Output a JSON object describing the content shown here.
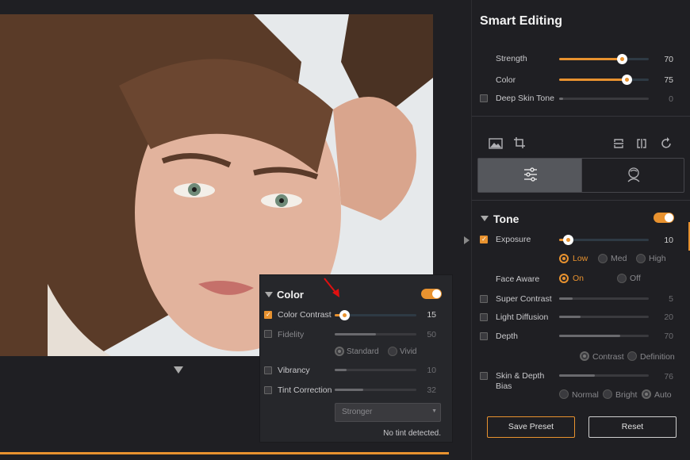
{
  "smart_editing": {
    "title": "Smart Editing",
    "strength": {
      "label": "Strength",
      "value": "70",
      "level": 0.7
    },
    "color": {
      "label": "Color",
      "value": "75",
      "level": 0.75
    },
    "deep_skin_tone": {
      "label": "Deep Skin Tone",
      "value": "0",
      "level": 0
    }
  },
  "tone": {
    "title": "Tone",
    "exposure": {
      "label": "Exposure",
      "value": "10",
      "level": 0.1
    },
    "exposure_options": [
      "Low",
      "Med",
      "High"
    ],
    "face_aware": {
      "label": "Face Aware",
      "options": [
        "On",
        "Off"
      ]
    },
    "super_contrast": {
      "label": "Super Contrast",
      "value": "5",
      "level": 0.15
    },
    "light_diffusion": {
      "label": "Light Diffusion",
      "value": "20",
      "level": 0.24
    },
    "depth": {
      "label": "Depth",
      "value": "70",
      "level": 0.68
    },
    "depth_options": [
      "Contrast",
      "Definition"
    ],
    "skin_depth_bias": {
      "label": "Skin & Depth Bias",
      "value": "76",
      "level": 0.4
    },
    "bias_options": [
      "Normal",
      "Bright",
      "Auto"
    ]
  },
  "buttons": {
    "save_preset": "Save Preset",
    "reset": "Reset"
  },
  "color_panel": {
    "title": "Color",
    "color_contrast": {
      "label": "Color Contrast",
      "value": "15",
      "level": 0.12
    },
    "fidelity": {
      "label": "Fidelity",
      "value": "50",
      "level": 0.5
    },
    "fidelity_options": [
      "Standard",
      "Vivid"
    ],
    "vibrancy": {
      "label": "Vibrancy",
      "value": "10",
      "level": 0.15
    },
    "tint_correction": {
      "label": "Tint Correction",
      "value": "32",
      "level": 0.35
    },
    "tint_select": "Stronger",
    "status": "No tint detected."
  },
  "colors": {
    "accent": "#e8922f",
    "bg": "#1f1f23",
    "panel": "#26272b"
  }
}
